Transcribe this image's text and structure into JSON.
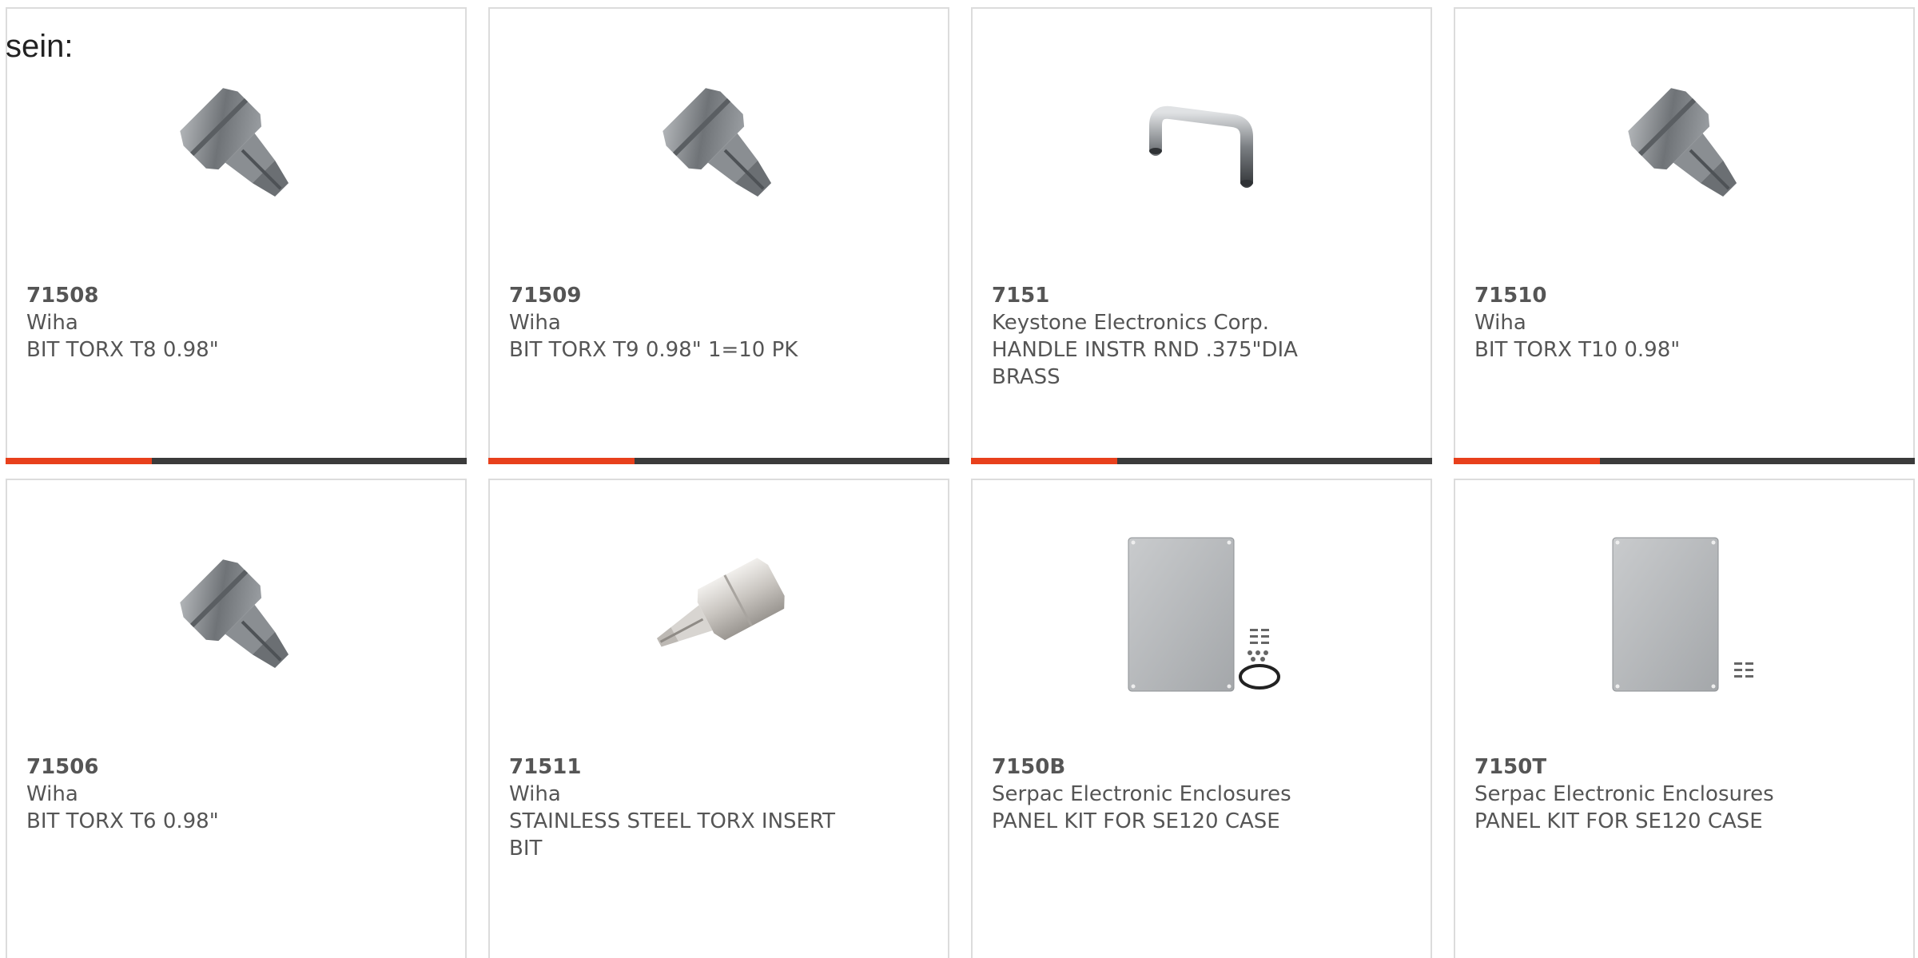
{
  "intro_text": "sein:",
  "colors": {
    "accent": "#e8401c",
    "bar": "#3b3b3b",
    "border": "#dcdcdc",
    "text": "#555555"
  },
  "products": [
    {
      "part_number": "71508",
      "manufacturer": "Wiha",
      "description": "BIT TORX T8 0.98\"",
      "image": "torx-bit-icon"
    },
    {
      "part_number": "71509",
      "manufacturer": "Wiha",
      "description": "BIT TORX T9 0.98\" 1=10 PK",
      "image": "torx-bit-icon"
    },
    {
      "part_number": "7151",
      "manufacturer": "Keystone Electronics Corp.",
      "description": "HANDLE INSTR RND .375\"DIA BRASS",
      "image": "handle-icon"
    },
    {
      "part_number": "71510",
      "manufacturer": "Wiha",
      "description": "BIT TORX T10 0.98\"",
      "image": "torx-bit-icon"
    },
    {
      "part_number": "71506",
      "manufacturer": "Wiha",
      "description": "BIT TORX T6 0.98\"",
      "image": "torx-bit-icon"
    },
    {
      "part_number": "71511",
      "manufacturer": "Wiha",
      "description": "STAINLESS STEEL TORX INSERT BIT",
      "image": "stainless-torx-bit-icon"
    },
    {
      "part_number": "7150B",
      "manufacturer": "Serpac Electronic Enclosures",
      "description": "PANEL KIT FOR SE120 CASE",
      "image": "panel-kit-icon"
    },
    {
      "part_number": "7150T",
      "manufacturer": "Serpac Electronic Enclosures",
      "description": "PANEL KIT FOR SE120 CASE",
      "image": "panel-kit-icon"
    }
  ]
}
